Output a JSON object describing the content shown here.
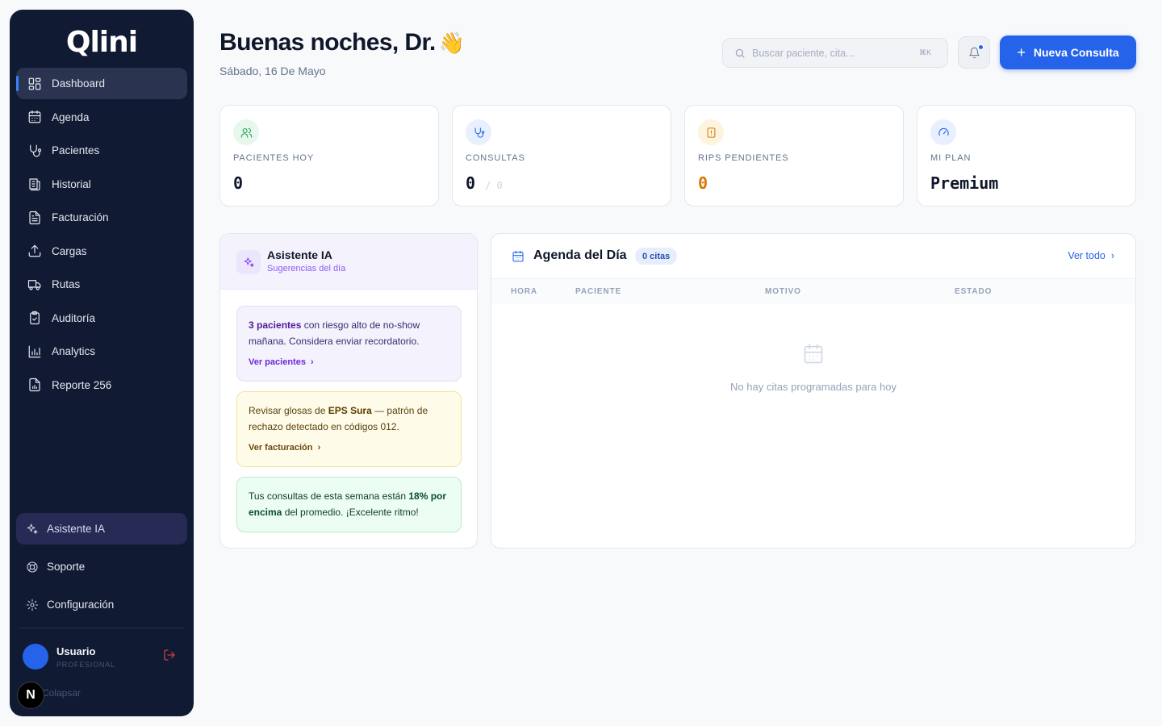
{
  "app": {
    "logo_text": "Qlini",
    "user_name": "Usuario",
    "user_role": "PROFESIONAL",
    "collapse_label": "Colapsar",
    "framework_badge": "N"
  },
  "sidebar": {
    "items": [
      {
        "label": "Dashboard",
        "icon": "dashboard-icon",
        "active": true
      },
      {
        "label": "Agenda",
        "icon": "calendar-icon"
      },
      {
        "label": "Pacientes",
        "icon": "stethoscope-icon"
      },
      {
        "label": "Historial",
        "icon": "history-icon"
      },
      {
        "label": "Facturación",
        "icon": "invoice-icon"
      },
      {
        "label": "Cargas",
        "icon": "upload-icon"
      },
      {
        "label": "Rutas",
        "icon": "truck-icon"
      },
      {
        "label": "Auditoría",
        "icon": "clipboard-check-icon"
      },
      {
        "label": "Analytics",
        "icon": "bar-chart-icon"
      },
      {
        "label": "Reporte 256",
        "icon": "report-icon"
      }
    ],
    "bottom": [
      {
        "label": "Asistente IA",
        "icon": "sparkles-icon"
      },
      {
        "label": "Soporte",
        "icon": "lifebuoy-icon"
      },
      {
        "label": "Configuración",
        "icon": "gear-icon"
      }
    ]
  },
  "header": {
    "greeting": "Buenas noches, Dr.",
    "emoji": "👋",
    "date": "Sábado, 16 De Mayo",
    "search_placeholder": "Buscar paciente, cita...",
    "search_shortcut": "⌘K",
    "new_button": "Nueva Consulta"
  },
  "stats": [
    {
      "label": "PACIENTES HOY",
      "value": "0",
      "icon": "users-icon",
      "accent": "#16a34a",
      "bg": "#e8f7ee"
    },
    {
      "label": "CONSULTAS",
      "value": "0",
      "sub": "/ 0",
      "icon": "stethoscope-icon",
      "accent": "#2563eb",
      "bg": "#e8efff"
    },
    {
      "label": "RIPS PENDIENTES",
      "value": "0",
      "icon": "alert-file-icon",
      "accent": "#d97706",
      "bg": "#fdf4de"
    },
    {
      "label": "MI PLAN",
      "value": "Premium",
      "icon": "gauge-icon",
      "accent": "#2563eb",
      "bg": "#e8efff"
    }
  ],
  "ai_panel": {
    "title": "Asistente IA",
    "subtitle": "Sugerencias del día",
    "suggestions": [
      {
        "strong": "3 pacientes",
        "text": " con riesgo alto de no-show mañana. Considera enviar recordatorio.",
        "link": "Ver pacientes"
      },
      {
        "pre": "Revisar glosas de ",
        "strong": "EPS Sura",
        "text": " — patrón de rechazo detectado en códigos 012.",
        "link": "Ver facturación"
      },
      {
        "pre": "Tus consultas de esta semana están ",
        "strong": "18% por encima",
        "text": " del promedio. ¡Excelente ritmo!"
      }
    ]
  },
  "agenda": {
    "title": "Agenda del Día",
    "badge": "0 citas",
    "view_all": "Ver todo",
    "columns": [
      "HORA",
      "PACIENTE",
      "MOTIVO",
      "ESTADO"
    ],
    "empty_text": "No hay citas programadas para hoy"
  },
  "colors": {
    "primary": "#2563eb",
    "sidebar_bg": "#111a33",
    "page_bg": "#f8f9fb"
  }
}
